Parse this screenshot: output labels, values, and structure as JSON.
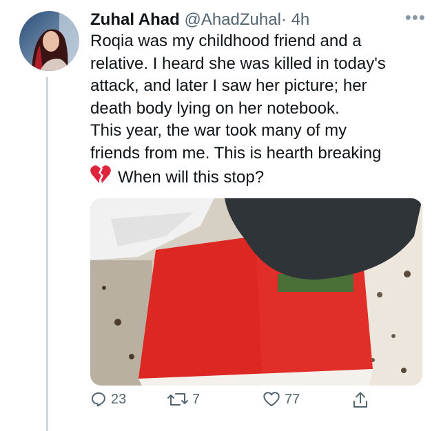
{
  "tweet": {
    "author_name": "Zuhal Ahad",
    "handle": "@AhadZuhal",
    "separator": "·",
    "timestamp": "4h",
    "more_label": "•••",
    "lines": [
      "Roqia was my childhood friend and a",
      "relative. I heard she was killed in today's",
      "attack, and later I saw her picture; her",
      "death body lying on her notebook.",
      "This year, the war took many of my",
      "friends from me. This is hearth breaking"
    ],
    "final_line": "When will this stop?",
    "emoji": "broken-heart-icon"
  },
  "actions": {
    "replies": "23",
    "retweets": "7",
    "likes": "77"
  },
  "colors": {
    "text": "#0f1419",
    "secondary": "#536471",
    "thread_line": "#cfd9de",
    "notebook_red": "#e02a24",
    "broken_heart": "#e0243b"
  }
}
